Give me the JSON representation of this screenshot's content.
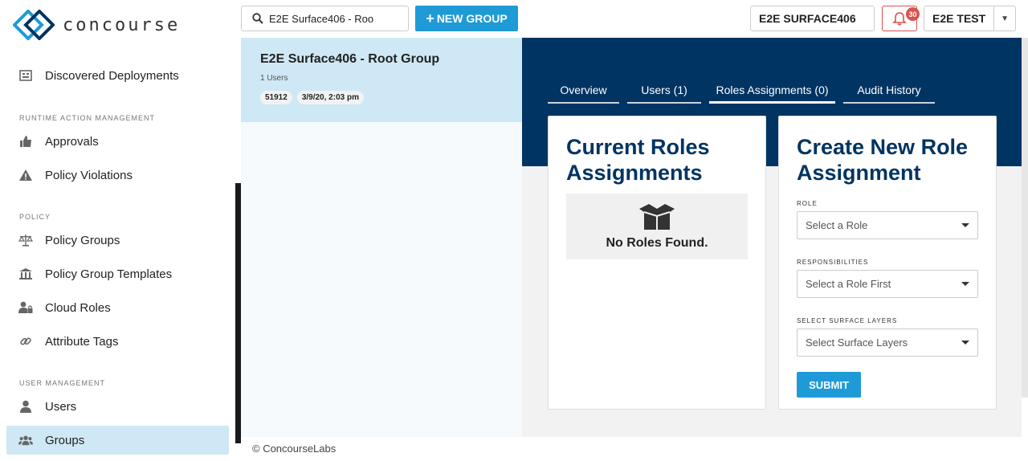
{
  "app": {
    "brand": "concourse",
    "footer": "© ConcourseLabs"
  },
  "sidebar": {
    "top_item": "Discovered Deployments",
    "sections": [
      {
        "label": "RUNTIME ACTION MANAGEMENT",
        "items": [
          "Approvals",
          "Policy Violations"
        ]
      },
      {
        "label": "POLICY",
        "items": [
          "Policy Groups",
          "Policy Group Templates",
          "Cloud Roles",
          "Attribute Tags"
        ]
      },
      {
        "label": "USER MANAGEMENT",
        "items": [
          "Users",
          "Groups"
        ]
      }
    ],
    "active_item": "Groups"
  },
  "topbar": {
    "search_value": "E2E Surface406 - Roo",
    "new_group_label": "NEW GROUP",
    "surface_label": "E2E SURFACE406",
    "notification_count": "30",
    "user_label": "E2E TEST"
  },
  "group": {
    "title": "E2E Surface406 - Root Group",
    "users": "1 Users",
    "id": "51912",
    "date": "3/9/20, 2:03 pm"
  },
  "tabs": [
    "Overview",
    "Users (1)",
    "Roles Assignments (0)",
    "Audit History"
  ],
  "current_roles": {
    "title_line1": "Current Roles",
    "title_line2": "Assignments",
    "empty_text": "No Roles Found."
  },
  "create_role": {
    "title_line1": "Create New Role",
    "title_line2": "Assignment",
    "role_label": "ROLE",
    "role_placeholder": "Select a Role",
    "resp_label": "RESPONSIBILITIES",
    "resp_placeholder": "Select a Role First",
    "layers_label": "SELECT SURFACE LAYERS",
    "layers_placeholder": "Select Surface Layers",
    "submit_label": "SUBMIT"
  },
  "colors": {
    "accent": "#1e9bd7",
    "header": "#003462",
    "active_bg": "#cfe8f5",
    "alert": "#d9534f"
  }
}
